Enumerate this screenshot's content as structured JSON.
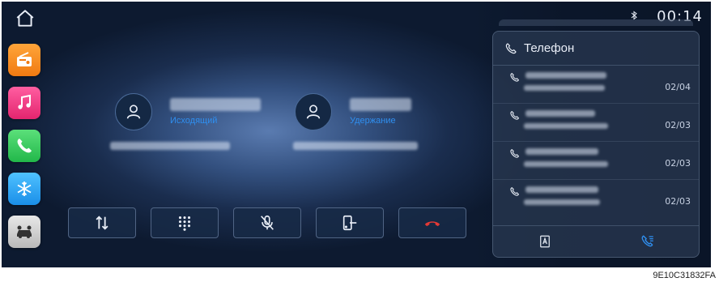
{
  "status": {
    "time": "00:14"
  },
  "callers": [
    {
      "status": "Исходящий"
    },
    {
      "status": "Удержание"
    }
  ],
  "panel": {
    "title": "Телефон"
  },
  "call_log": [
    {
      "date": "02/04"
    },
    {
      "date": "02/03"
    },
    {
      "date": "02/03"
    },
    {
      "date": "02/03"
    }
  ],
  "figure_code": "9E10C31832FA",
  "colors": {
    "accent": "#2f8ff0",
    "end_call": "#e53935"
  }
}
